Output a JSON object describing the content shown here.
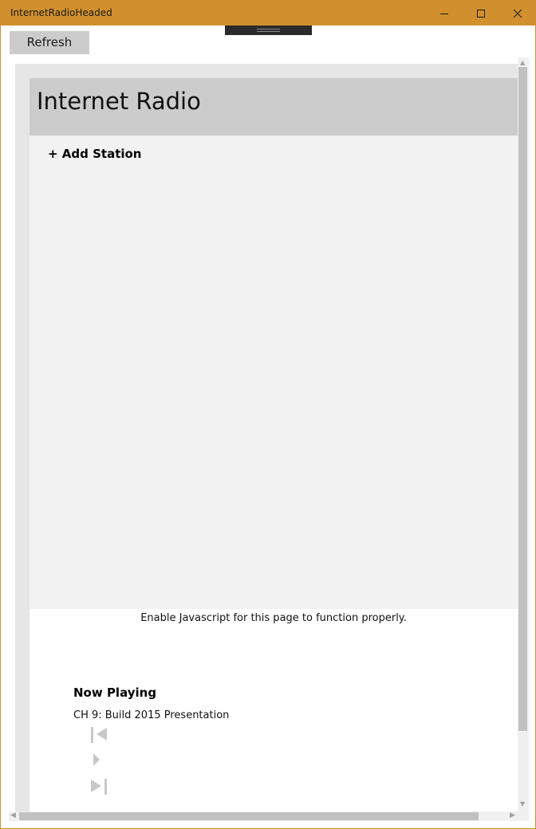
{
  "window": {
    "title": "InternetRadioHeaded"
  },
  "toolbar": {
    "refresh_label": "Refresh"
  },
  "page": {
    "app_title": "Internet Radio",
    "add_station_label": "+ Add Station",
    "noscript_message": "Enable Javascript for this page to function properly.",
    "now_playing": {
      "heading": "Now Playing",
      "track": "CH 9: Build 2015 Presentation"
    }
  },
  "colors": {
    "titlebar": "#d1902d",
    "header_band": "#cccccc",
    "panel": "#f2f2f2",
    "controls": "#c8c8c8"
  },
  "icons": {
    "minimize": "minimize-icon",
    "maximize": "maximize-icon",
    "close": "close-icon",
    "previous": "skip-previous-icon",
    "play": "play-icon",
    "next": "skip-next-icon"
  }
}
